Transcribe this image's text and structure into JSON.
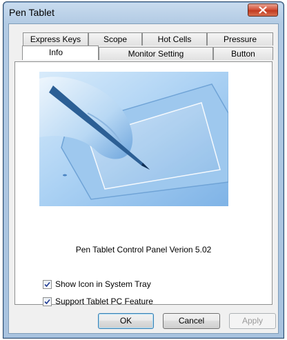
{
  "window": {
    "title": "Pen Tablet"
  },
  "tabs": {
    "row_back": [
      "Express Keys",
      "Scope",
      "Hot Cells",
      "Pressure"
    ],
    "row_front": [
      "Info",
      "Monitor Setting",
      "Button"
    ],
    "selected": "Info"
  },
  "info": {
    "caption": "Pen Tablet Control Panel Verion 5.02",
    "options": [
      {
        "label": "Show Icon in System Tray",
        "checked": true
      },
      {
        "label": "Support Tablet PC Feature",
        "checked": true
      }
    ]
  },
  "buttons": {
    "ok": "OK",
    "cancel": "Cancel",
    "apply": "Apply"
  },
  "colors": {
    "accent": "#5b9bdc",
    "image_blue": "#8fbde8"
  },
  "icons": {
    "close": "close-icon",
    "check": "check-icon"
  }
}
